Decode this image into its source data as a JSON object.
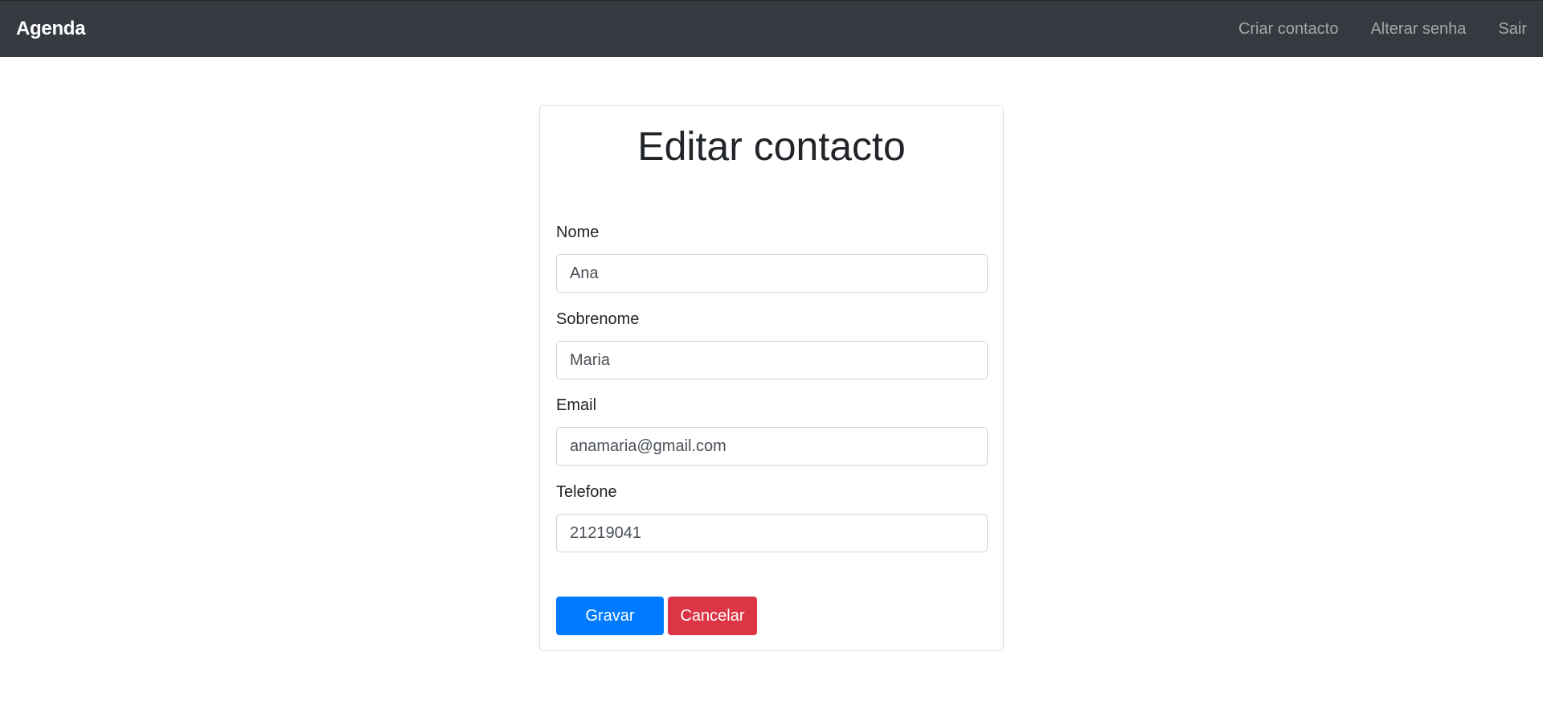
{
  "navbar": {
    "brand": "Agenda",
    "links": [
      "Criar contacto",
      "Alterar senha",
      "Sair"
    ]
  },
  "form": {
    "title": "Editar contacto",
    "fields": [
      {
        "label": "Nome",
        "value": "Ana"
      },
      {
        "label": "Sobrenome",
        "value": "Maria"
      },
      {
        "label": "Email",
        "value": "anamaria@gmail.com"
      },
      {
        "label": "Telefone",
        "value": "21219041"
      }
    ],
    "save_label": "Gravar",
    "cancel_label": "Cancelar"
  },
  "colors": {
    "navbar": "#343a40",
    "primary": "#007bff",
    "danger": "#dc3545"
  }
}
